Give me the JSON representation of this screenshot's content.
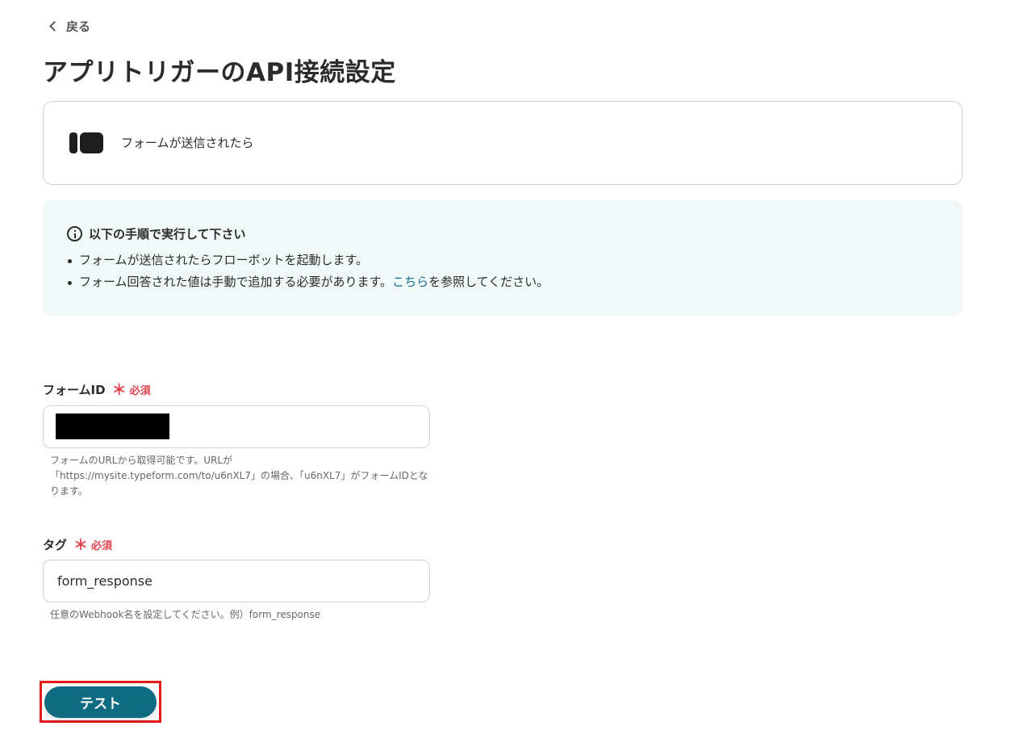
{
  "nav": {
    "back_label": "戻る"
  },
  "page": {
    "title": "アプリトリガーのAPI接続設定"
  },
  "app_card": {
    "icon": "typeform-logo-icon",
    "label": "フォームが送信されたら"
  },
  "info": {
    "heading": "以下の手順で実行して下さい",
    "items": [
      "フォームが送信されたらフローボットを起動します。",
      "フォーム回答された値は手動で追加する必要があります。"
    ],
    "link_text": "こちら",
    "link_suffix": "を参照してください。"
  },
  "fields": {
    "form_id": {
      "label": "フォームID",
      "required_mark": "＊",
      "required_text": "必須",
      "value": "",
      "redacted": true,
      "help": "フォームのURLから取得可能です。URLが「https://mysite.typeform.com/to/u6nXL7」の場合、「u6nXL7」がフォームIDとなります。"
    },
    "tag": {
      "label": "タグ",
      "required_mark": "＊",
      "required_text": "必須",
      "value": "form_response",
      "help": "任意のWebhook名を設定してください。例）form_response"
    }
  },
  "actions": {
    "test_label": "テスト",
    "highlight_color": "#e21b1b",
    "button_color": "#0e6b82"
  }
}
